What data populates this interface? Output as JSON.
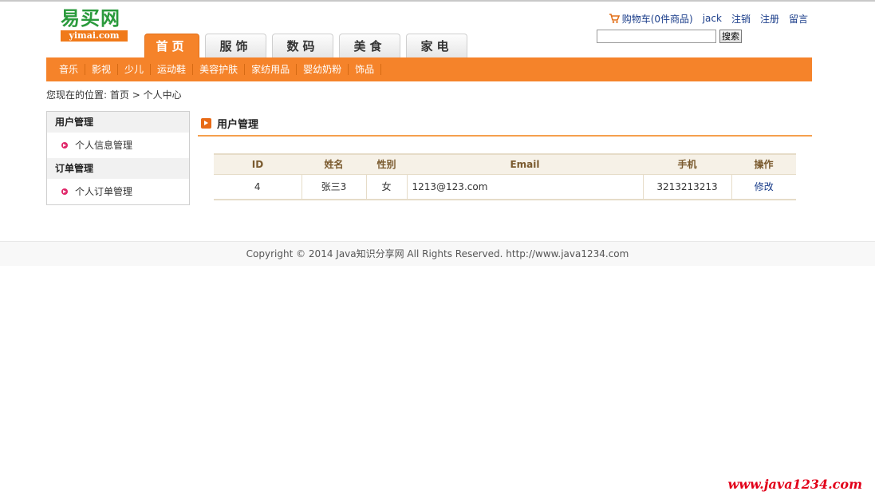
{
  "logo": {
    "cn": "易买网",
    "en": "yimai.com"
  },
  "tabs": [
    {
      "label": "首页",
      "active": true
    },
    {
      "label": "服饰"
    },
    {
      "label": "数码"
    },
    {
      "label": "美食"
    },
    {
      "label": "家电"
    }
  ],
  "userbar": {
    "cart_icon": "cart-icon",
    "cart": "购物车(0件商品)",
    "username": "jack",
    "logout": "注销",
    "register": "注册",
    "message": "留言"
  },
  "search": {
    "button": "搜索",
    "value": ""
  },
  "subnav": [
    "音乐",
    "影视",
    "少儿",
    "运动鞋",
    "美容护肤",
    "家纺用品",
    "婴幼奶粉",
    "饰品"
  ],
  "breadcrumb": {
    "prefix": "您现在的位置: ",
    "home": "首页",
    "sep": " > ",
    "current": "个人中心"
  },
  "sidebar": {
    "groups": [
      {
        "title": "用户管理",
        "items": [
          "个人信息管理"
        ]
      },
      {
        "title": "订单管理",
        "items": [
          "个人订单管理"
        ]
      }
    ]
  },
  "main": {
    "title": "用户管理",
    "columns": [
      "ID",
      "姓名",
      "性别",
      "Email",
      "手机",
      "操作"
    ],
    "rows": [
      {
        "id": "4",
        "name": "张三3",
        "gender": "女",
        "email": "1213@123.com",
        "phone": "3213213213",
        "action": "修改"
      }
    ]
  },
  "footer": "Copyright © 2014 Java知识分享网 All Rights Reserved. http://www.java1234.com",
  "watermark": "www.java1234.com",
  "colors": {
    "accent": "#f5832a",
    "link": "#1a3d8a",
    "logo_green": "#2a9a3c",
    "watermark": "#e2001a"
  }
}
